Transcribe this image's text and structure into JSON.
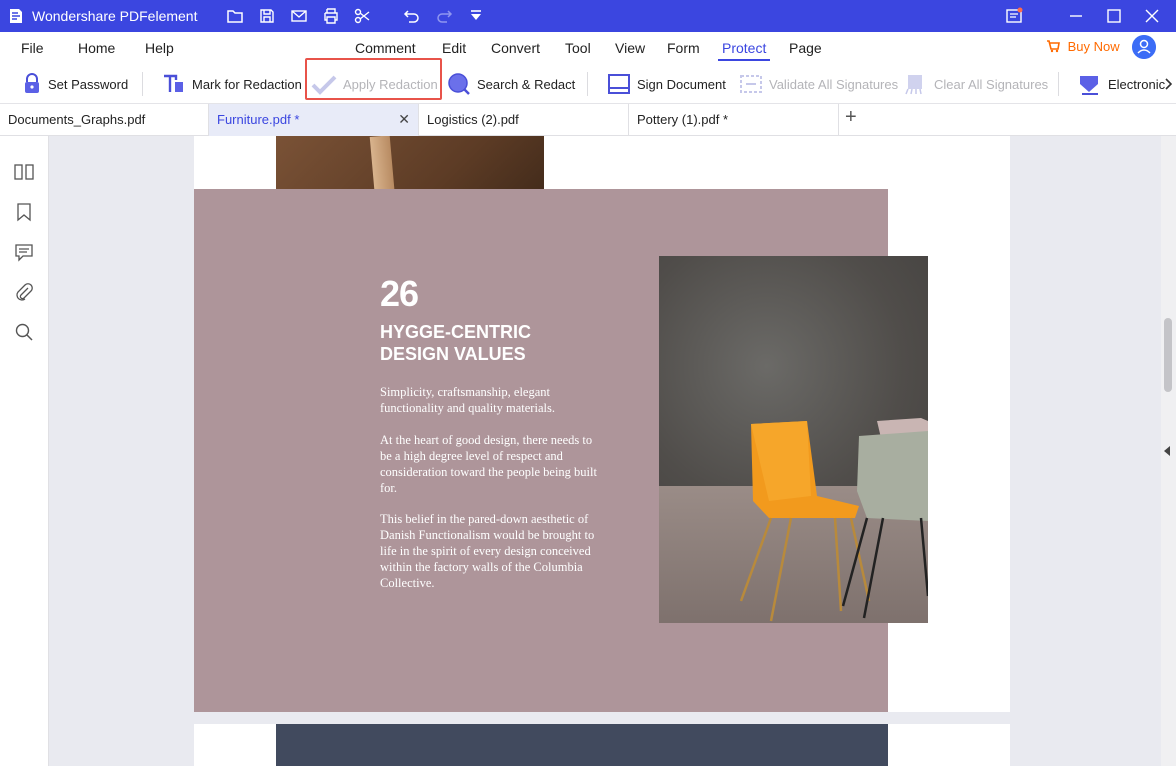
{
  "app": {
    "title": "Wondershare PDFelement",
    "accent": "#3b46e0"
  },
  "menu": {
    "items": [
      "File",
      "Home",
      "Help",
      "Comment",
      "Edit",
      "Convert",
      "Tool",
      "View",
      "Form",
      "Protect",
      "Page"
    ],
    "active": "Protect",
    "buy_now": "Buy Now"
  },
  "toolbar": {
    "set_password": "Set Password",
    "mark_for_redaction": "Mark for Redaction",
    "apply_redaction": "Apply Redaction",
    "search_redact": "Search & Redact",
    "sign_document": "Sign Document",
    "validate_all_signatures": "Validate All Signatures",
    "clear_all_signatures": "Clear All Signatures",
    "electronic": "Electronic"
  },
  "tabs": [
    {
      "label": "Documents_Graphs.pdf"
    },
    {
      "label": "Furniture.pdf *"
    },
    {
      "label": "Logistics (2).pdf"
    },
    {
      "label": "Pottery (1).pdf *"
    }
  ],
  "document": {
    "number": "26",
    "heading_line1": "HYGGE-CENTRIC",
    "heading_line2": "DESIGN VALUES",
    "para1": "Simplicity, craftsmanship, elegant functionality and quality materials.",
    "para2": "At the heart of good design, there needs to be a high degree level of respect and consideration toward the people being built for.",
    "para3": "This belief in the pared-down aesthetic of Danish Functionalism would be brought to life in the spirit of every design conceived within the factory walls of the Columbia Collective."
  }
}
